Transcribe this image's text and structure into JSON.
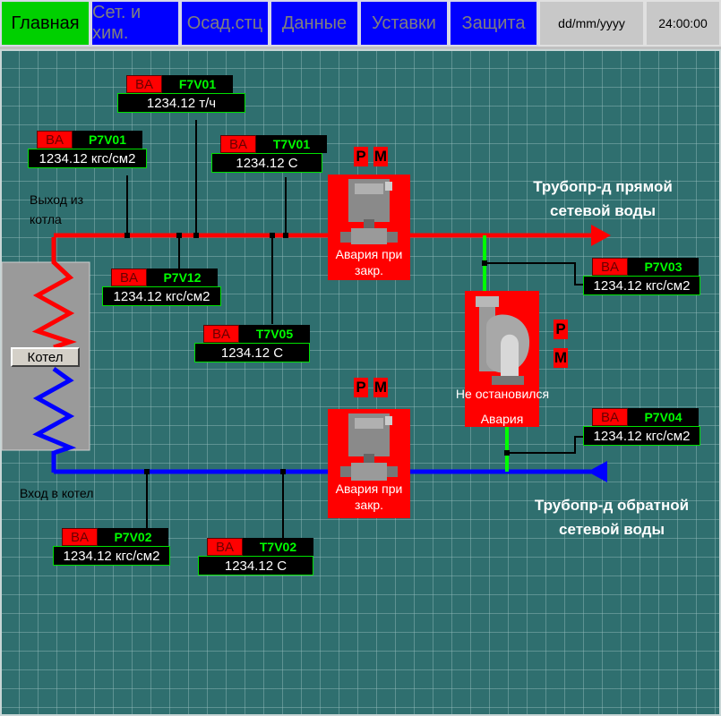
{
  "nav": {
    "tabs": [
      "Главная",
      "Сет. и хим.",
      "Осад.стц",
      "Данные",
      "Уставки",
      "Защита"
    ],
    "date": "dd/mm/yyyy",
    "time": "24:00:00"
  },
  "tags": [
    {
      "ba": "BA",
      "name": "F7V01",
      "value": "1234.12  т/ч"
    },
    {
      "ba": "BA",
      "name": "P7V01",
      "value": "1234.12 кгс/см2"
    },
    {
      "ba": "BA",
      "name": "T7V01",
      "value": "1234.12  C"
    },
    {
      "ba": "BA",
      "name": "P7V12",
      "value": "1234.12 кгс/см2"
    },
    {
      "ba": "BA",
      "name": "T7V05",
      "value": "1234.12   C"
    },
    {
      "ba": "BA",
      "name": "P7V03",
      "value": "1234.12 кгс/см2"
    },
    {
      "ba": "BA",
      "name": "P7V04",
      "value": "1234.12 кгс/см2"
    },
    {
      "ba": "BA",
      "name": "P7V02",
      "value": "1234.12 кгс/см2"
    },
    {
      "ba": "BA",
      "name": "T7V02",
      "value": "1234.12   C"
    }
  ],
  "labels": {
    "exit": "Выход из котла",
    "entry": "Вход в котел",
    "kotel": "Котел",
    "pipe_direct": "Трубопр-д прямой сетевой воды",
    "pipe_return": "Трубопр-д обратной сетевой воды"
  },
  "pm": {
    "p": "P",
    "m": "M"
  },
  "valve_top": {
    "status": "Авария при закр."
  },
  "valve_bottom": {
    "status": "Авария при закр."
  },
  "pump": {
    "status1": "Не остановился",
    "status2": "Авария"
  },
  "colors": {
    "supply": "#ff0000",
    "return": "#0000ff",
    "bypass": "#00ff00",
    "nav_active": "#00d000",
    "nav_tab": "#0000ff"
  }
}
